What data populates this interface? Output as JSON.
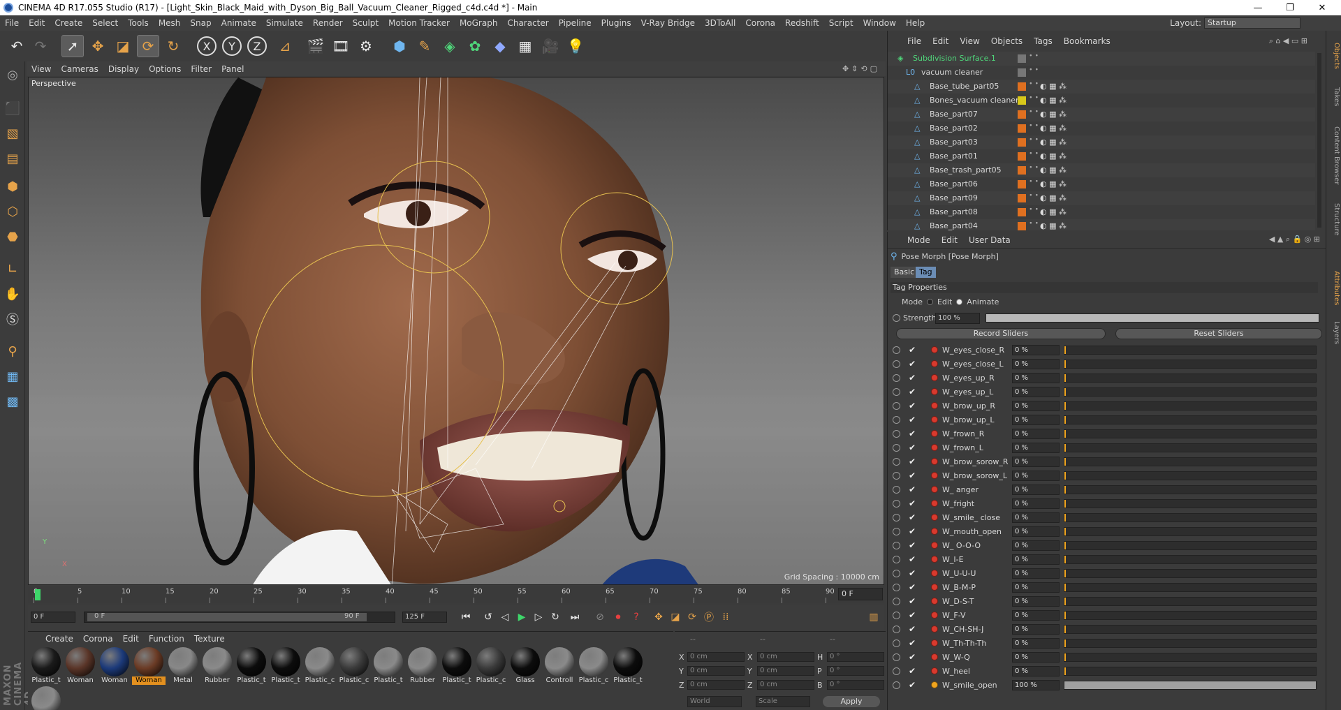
{
  "window": {
    "title": "CINEMA 4D R17.055 Studio (R17) - [Light_Skin_Black_Maid_with_Dyson_Big_Ball_Vacuum_Cleaner_Rigged_c4d.c4d *] - Main",
    "minimize": "—",
    "maximize": "❐",
    "close": "✕"
  },
  "menubar": {
    "items": [
      "File",
      "Edit",
      "Create",
      "Select",
      "Tools",
      "Mesh",
      "Snap",
      "Animate",
      "Simulate",
      "Render",
      "Sculpt",
      "Motion Tracker",
      "MoGraph",
      "Character",
      "Pipeline",
      "Plugins",
      "V-Ray Bridge",
      "3DToAll",
      "Corona",
      "Redshift",
      "Script",
      "Window",
      "Help"
    ],
    "layout_label": "Layout:",
    "layout_value": "Startup"
  },
  "toolbar": {
    "x_axis": "X",
    "y_axis": "Y",
    "z_axis": "Z"
  },
  "left_tools": {
    "brand": "MAXON CINEMA 4D"
  },
  "viewport": {
    "menu": [
      "View",
      "Cameras",
      "Display",
      "Options",
      "Filter",
      "Panel"
    ],
    "label": "Perspective",
    "grid_spacing": "Grid Spacing : 10000 cm",
    "axis_y": "Y",
    "axis_x": "X"
  },
  "timeline": {
    "ticks": [
      "0",
      "5",
      "10",
      "15",
      "20",
      "25",
      "30",
      "35",
      "40",
      "45",
      "50",
      "55",
      "60",
      "65",
      "70",
      "75",
      "80",
      "85",
      "90"
    ],
    "current_frame": "0 F"
  },
  "transport": {
    "start_frame": "0 F",
    "range_start": "0 F",
    "range_end": "90 F",
    "end_frame": "125 F"
  },
  "materials": {
    "menu": [
      "Create",
      "Corona",
      "Edit",
      "Function",
      "Texture"
    ],
    "items": [
      {
        "name": "Plastic_t",
        "color": "#1a1a1a"
      },
      {
        "name": "Woman",
        "color": "#5a3528"
      },
      {
        "name": "Woman",
        "color": "#1c3a7a"
      },
      {
        "name": "Woman",
        "color": "#6b3b25",
        "selected": true
      },
      {
        "name": "Metal",
        "color": "#888888"
      },
      {
        "name": "Rubber",
        "color": "#8a8a8a"
      },
      {
        "name": "Plastic_t",
        "color": "#0c0c0c"
      },
      {
        "name": "Plastic_t",
        "color": "#0c0c0c"
      },
      {
        "name": "Plastic_c",
        "color": "#8a8a8a"
      },
      {
        "name": "Plastic_c",
        "color": "#3a3a3a"
      },
      {
        "name": "Plastic_t",
        "color": "#8a8a8a"
      },
      {
        "name": "Rubber",
        "color": "#8a8a8a"
      },
      {
        "name": "Plastic_t",
        "color": "#0c0c0c"
      },
      {
        "name": "Plastic_c",
        "color": "#3a3a3a"
      },
      {
        "name": "Glass",
        "color": "#0c0c0c"
      },
      {
        "name": "Controll",
        "color": "#8a8a8a"
      },
      {
        "name": "Plastic_c",
        "color": "#8a8a8a"
      },
      {
        "name": "Plastic_t",
        "color": "#0c0c0c"
      },
      {
        "name": "",
        "color": "#8a8a8a"
      }
    ]
  },
  "coordinates": {
    "headers": [
      "--",
      "--",
      "--"
    ],
    "rows": [
      {
        "a": "X",
        "av": "0 cm",
        "b": "X",
        "bv": "0 cm",
        "c": "H",
        "cv": "0 °"
      },
      {
        "a": "Y",
        "av": "0 cm",
        "b": "Y",
        "bv": "0 cm",
        "c": "P",
        "cv": "0 °"
      },
      {
        "a": "Z",
        "av": "0 cm",
        "b": "Z",
        "bv": "0 cm",
        "c": "B",
        "cv": "0 °"
      }
    ],
    "space": "World",
    "mode": "Scale",
    "apply": "Apply"
  },
  "objects": {
    "menu": [
      "File",
      "Edit",
      "View",
      "Objects",
      "Tags",
      "Bookmarks"
    ],
    "items": [
      {
        "name": "Subdivision Surface.1",
        "indent": 0,
        "tag": ""
      },
      {
        "name": "vacuum cleaner",
        "indent": 1,
        "tag": ""
      },
      {
        "name": "Base_tube_part05",
        "indent": 2,
        "tag": "#e07020"
      },
      {
        "name": "Bones_vacuum cleaner",
        "indent": 2,
        "tag": "#d8c81a"
      },
      {
        "name": "Base_part07",
        "indent": 2,
        "tag": "#e07020"
      },
      {
        "name": "Base_part02",
        "indent": 2,
        "tag": "#e07020"
      },
      {
        "name": "Base_part03",
        "indent": 2,
        "tag": "#e07020"
      },
      {
        "name": "Base_part01",
        "indent": 2,
        "tag": "#e07020"
      },
      {
        "name": "Base_trash_part05",
        "indent": 2,
        "tag": "#e07020"
      },
      {
        "name": "Base_part06",
        "indent": 2,
        "tag": "#e07020"
      },
      {
        "name": "Base_part09",
        "indent": 2,
        "tag": "#e07020"
      },
      {
        "name": "Base_part08",
        "indent": 2,
        "tag": "#e07020"
      },
      {
        "name": "Base_part04",
        "indent": 2,
        "tag": "#e07020"
      }
    ]
  },
  "attributes": {
    "menu": [
      "Mode",
      "Edit",
      "User Data"
    ],
    "object_title": "Pose Morph [Pose Morph]",
    "tab_basic": "Basic",
    "tab_tag": "Tag",
    "section": "Tag Properties",
    "mode_label": "Mode",
    "mode_edit": "Edit",
    "mode_animate": "Animate",
    "strength_label": "Strength",
    "strength_value": "100 %",
    "record": "Record Sliders",
    "reset": "Reset Sliders",
    "morphs": [
      {
        "name": "W_eyes_close_R",
        "value": "0 %",
        "fill": 0
      },
      {
        "name": "W_eyes_close_L",
        "value": "0 %",
        "fill": 0
      },
      {
        "name": "W_eyes_up_R",
        "value": "0 %",
        "fill": 0
      },
      {
        "name": "W_eyes_up_L",
        "value": "0 %",
        "fill": 0
      },
      {
        "name": "W_brow_up_R",
        "value": "0 %",
        "fill": 0
      },
      {
        "name": "W_brow_up_L",
        "value": "0 %",
        "fill": 0
      },
      {
        "name": "W_frown_R",
        "value": "0 %",
        "fill": 0
      },
      {
        "name": "W_frown_L",
        "value": "0 %",
        "fill": 0
      },
      {
        "name": "W_brow_sorow_R",
        "value": "0 %",
        "fill": 0
      },
      {
        "name": "W_brow_sorow_L",
        "value": "0 %",
        "fill": 0
      },
      {
        "name": "W_ anger",
        "value": "0 %",
        "fill": 0
      },
      {
        "name": "W_fright",
        "value": "0 %",
        "fill": 0
      },
      {
        "name": "W_smile_ close",
        "value": "0 %",
        "fill": 0
      },
      {
        "name": "W_mouth_open",
        "value": "0 %",
        "fill": 0
      },
      {
        "name": "W_ O-O-O",
        "value": "0 %",
        "fill": 0
      },
      {
        "name": "W_I-E",
        "value": "0 %",
        "fill": 0
      },
      {
        "name": "W_U-U-U",
        "value": "0 %",
        "fill": 0
      },
      {
        "name": "W_B-M-P",
        "value": "0 %",
        "fill": 0
      },
      {
        "name": "W_D-S-T",
        "value": "0 %",
        "fill": 0
      },
      {
        "name": "W_F-V",
        "value": "0 %",
        "fill": 0
      },
      {
        "name": "W_CH-SH-J",
        "value": "0 %",
        "fill": 0
      },
      {
        "name": "W_Th-Th-Th",
        "value": "0 %",
        "fill": 0
      },
      {
        "name": "W_W-Q",
        "value": "0 %",
        "fill": 0
      },
      {
        "name": "W_heel",
        "value": "0 %",
        "fill": 0
      },
      {
        "name": "W_smile_open",
        "value": "100 %",
        "fill": 1
      }
    ]
  },
  "right_tabs": [
    "Objects",
    "Takes",
    "Content Browser",
    "Structure",
    "Attributes",
    "Layers"
  ],
  "colors": {
    "accent": "#f0a51f",
    "panel": "#3b3b3b",
    "tab_active": "#6b8db5"
  }
}
